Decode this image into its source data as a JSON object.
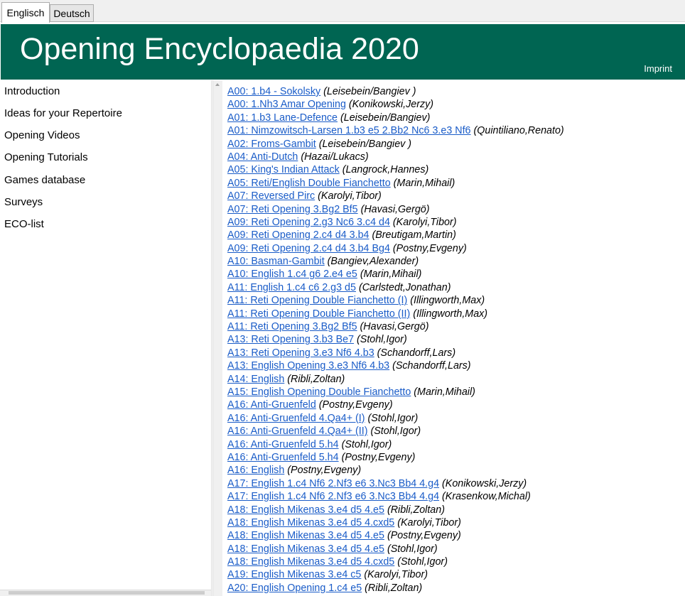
{
  "tabs": [
    {
      "label": "Englisch",
      "active": true
    },
    {
      "label": "Deutsch",
      "active": false
    }
  ],
  "banner": {
    "title": "Opening Encyclopaedia 2020",
    "imprint": "Imprint",
    "color": "#006552"
  },
  "nav": {
    "items": [
      "Introduction",
      "Ideas for your Repertoire",
      "Opening Videos",
      "Opening Tutorials",
      "Games database",
      "Surveys",
      "ECO-list"
    ]
  },
  "entries": [
    {
      "link": "A00: 1.b4 - Sokolsky",
      "author": "(Leisebein/Bangiev )"
    },
    {
      "link": "A00: 1.Nh3 Amar Opening",
      "author": "(Konikowski,Jerzy)"
    },
    {
      "link": "A01: 1.b3 Lane-Defence",
      "author": "(Leisebein/Bangiev)"
    },
    {
      "link": "A01: Nimzowitsch-Larsen 1.b3 e5 2.Bb2 Nc6 3.e3 Nf6",
      "author": "(Quintiliano,Renato)"
    },
    {
      "link": "A02: Froms-Gambit",
      "author": "(Leisebein/Bangiev )"
    },
    {
      "link": "A04: Anti-Dutch",
      "author": "(Hazai/Lukacs)"
    },
    {
      "link": "A05: King's Indian Attack",
      "author": "(Langrock,Hannes)"
    },
    {
      "link": "A05: Reti/English Double Fianchetto",
      "author": "(Marin,Mihail)"
    },
    {
      "link": "A07: Reversed Pirc",
      "author": "(Karolyi,Tibor)"
    },
    {
      "link": "A07: Reti Opening 3.Bg2 Bf5",
      "author": "(Havasi,Gergö)"
    },
    {
      "link": "A09: Reti Opening 2.g3 Nc6 3.c4 d4",
      "author": "(Karolyi,Tibor)"
    },
    {
      "link": "A09: Reti Opening 2.c4 d4 3.b4",
      "author": "(Breutigam,Martin)"
    },
    {
      "link": "A09: Reti Opening 2.c4 d4 3.b4 Bg4",
      "author": "(Postny,Evgeny)"
    },
    {
      "link": "A10: Basman-Gambit",
      "author": "(Bangiev,Alexander)"
    },
    {
      "link": "A10: English 1.c4 g6 2.e4 e5",
      "author": "(Marin,Mihail)"
    },
    {
      "link": "A11: English 1.c4 c6 2.g3 d5",
      "author": "(Carlstedt,Jonathan)"
    },
    {
      "link": "A11: Reti Opening Double Fianchetto (I)",
      "author": "(Illingworth,Max)"
    },
    {
      "link": "A11: Reti Opening Double Fianchetto (II)",
      "author": "(Illingworth,Max)"
    },
    {
      "link": "A11: Reti Opening 3.Bg2 Bf5",
      "author": "(Havasi,Gergö)"
    },
    {
      "link": "A13: Reti Opening 3.b3 Be7",
      "author": "(Stohl,Igor)"
    },
    {
      "link": "A13: Reti Opening 3.e3 Nf6 4.b3",
      "author": "(Schandorff,Lars)"
    },
    {
      "link": "A13: English Opening 3.e3 Nf6 4.b3",
      "author": "(Schandorff,Lars)"
    },
    {
      "link": "A14: English",
      "author": "(Ribli,Zoltan)"
    },
    {
      "link": "A15: English Opening Double Fianchetto",
      "author": "(Marin,Mihail)"
    },
    {
      "link": "A16: Anti-Gruenfeld",
      "author": "(Postny,Evgeny)"
    },
    {
      "link": "A16: Anti-Gruenfeld 4.Qa4+ (I)",
      "author": "(Stohl,Igor)"
    },
    {
      "link": "A16: Anti-Gruenfeld 4.Qa4+ (II)",
      "author": "(Stohl,Igor)"
    },
    {
      "link": "A16: Anti-Gruenfeld 5.h4",
      "author": "(Stohl,Igor)"
    },
    {
      "link": "A16: Anti-Gruenfeld 5.h4",
      "author": "(Postny,Evgeny)"
    },
    {
      "link": "A16: English",
      "author": "(Postny,Evgeny)"
    },
    {
      "link": "A17: English 1.c4 Nf6 2.Nf3 e6 3.Nc3 Bb4 4.g4",
      "author": "(Konikowski,Jerzy)"
    },
    {
      "link": "A17: English 1.c4 Nf6 2.Nf3 e6 3.Nc3 Bb4 4.g4",
      "author": "(Krasenkow,Michal)"
    },
    {
      "link": "A18: English Mikenas 3.e4 d5 4.e5",
      "author": "(Ribli,Zoltan)"
    },
    {
      "link": "A18: English Mikenas 3.e4 d5 4.cxd5",
      "author": "(Karolyi,Tibor)"
    },
    {
      "link": "A18: English Mikenas 3.e4 d5 4.e5",
      "author": "(Postny,Evgeny)"
    },
    {
      "link": "A18: English Mikenas 3.e4 d5 4.e5",
      "author": "(Stohl,Igor)"
    },
    {
      "link": "A18: English Mikenas 3.e4 d5 4.cxd5",
      "author": "(Stohl,Igor)"
    },
    {
      "link": "A19: English Mikenas 3.e4 c5",
      "author": "(Karolyi,Tibor)"
    },
    {
      "link": "A20: English Opening 1.c4 e5",
      "author": "(Ribli,Zoltan)"
    }
  ]
}
